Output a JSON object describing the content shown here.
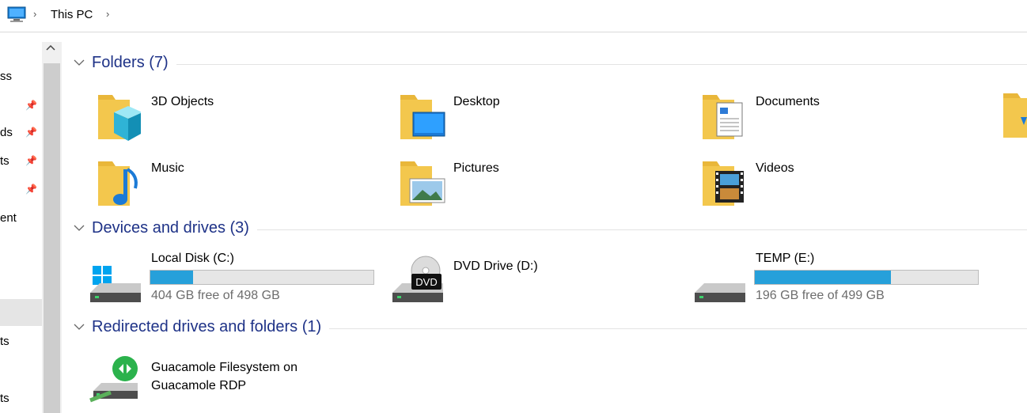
{
  "address_bar": {
    "location": "This PC",
    "separator": "›"
  },
  "nav_pane": {
    "items": [
      {
        "label": "ss",
        "pinned": false
      },
      {
        "label": "",
        "pinned": true
      },
      {
        "label": "ds",
        "pinned": true
      },
      {
        "label": "ts",
        "pinned": true
      },
      {
        "label": "",
        "pinned": true
      },
      {
        "label": "ent",
        "pinned": false
      },
      {
        "label": "ts",
        "pinned": false
      },
      {
        "label": "ts",
        "pinned": false
      }
    ]
  },
  "groups": {
    "folders": {
      "title": "Folders (7)"
    },
    "devices": {
      "title": "Devices and drives (3)"
    },
    "redirected": {
      "title": "Redirected drives and folders (1)"
    }
  },
  "folders": [
    {
      "name": "3D Objects",
      "icon": "3d-objects-folder-icon"
    },
    {
      "name": "Desktop",
      "icon": "desktop-folder-icon"
    },
    {
      "name": "Documents",
      "icon": "documents-folder-icon"
    },
    {
      "name": "Music",
      "icon": "music-folder-icon"
    },
    {
      "name": "Pictures",
      "icon": "pictures-folder-icon"
    },
    {
      "name": "Videos",
      "icon": "videos-folder-icon"
    }
  ],
  "drives": [
    {
      "name": "Local Disk (C:)",
      "free_text": "404 GB free of 498 GB",
      "used_fraction": 0.19
    },
    {
      "name": "DVD Drive (D:)",
      "dvd_label": "DVD"
    },
    {
      "name": "TEMP (E:)",
      "free_text": "196 GB free of 499 GB",
      "used_fraction": 0.61
    }
  ],
  "redirected": [
    {
      "line1": "Guacamole Filesystem on",
      "line2": "Guacamole RDP"
    }
  ],
  "colors": {
    "group_title": "#1e3287",
    "bar_fill": "#26a0da",
    "folder": "#f3c74d"
  }
}
